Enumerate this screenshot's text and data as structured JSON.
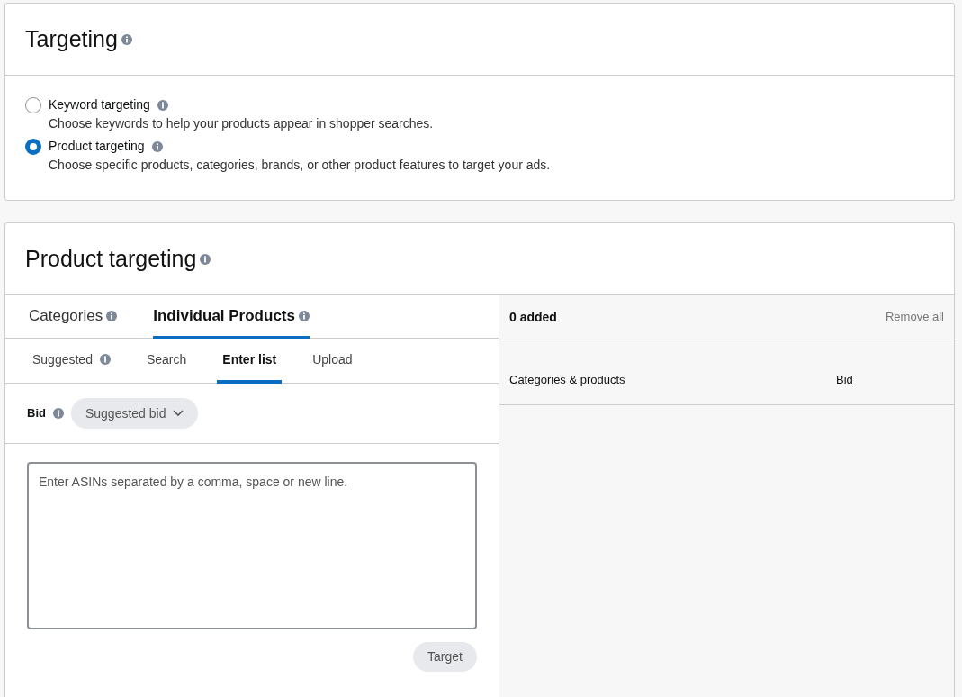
{
  "targeting": {
    "title": "Targeting",
    "options": [
      {
        "label": "Keyword targeting",
        "description": "Choose keywords to help your products appear in shopper searches.",
        "selected": false
      },
      {
        "label": "Product targeting",
        "description": "Choose specific products, categories, brands, or other product features to target your ads.",
        "selected": true
      }
    ]
  },
  "product_targeting": {
    "title": "Product targeting",
    "tabs": [
      {
        "label": "Categories",
        "info": true,
        "selected": false
      },
      {
        "label": "Individual Products",
        "info": true,
        "selected": true
      }
    ],
    "subtabs": [
      {
        "label": "Suggested",
        "info": true,
        "selected": false
      },
      {
        "label": "Search",
        "info": false,
        "selected": false
      },
      {
        "label": "Enter list",
        "info": false,
        "selected": true
      },
      {
        "label": "Upload",
        "info": false,
        "selected": false
      }
    ],
    "bid_label": "Bid",
    "bid_dropdown": "Suggested bid",
    "asin_field": {
      "placeholder": "Enter ASINs separated by a comma, space or new line."
    },
    "target_button": {
      "label": "Target",
      "disabled": true
    },
    "added": {
      "count": "0 added",
      "remove_all": "Remove all",
      "columns": [
        "Categories & products",
        "Bid"
      ]
    }
  }
}
